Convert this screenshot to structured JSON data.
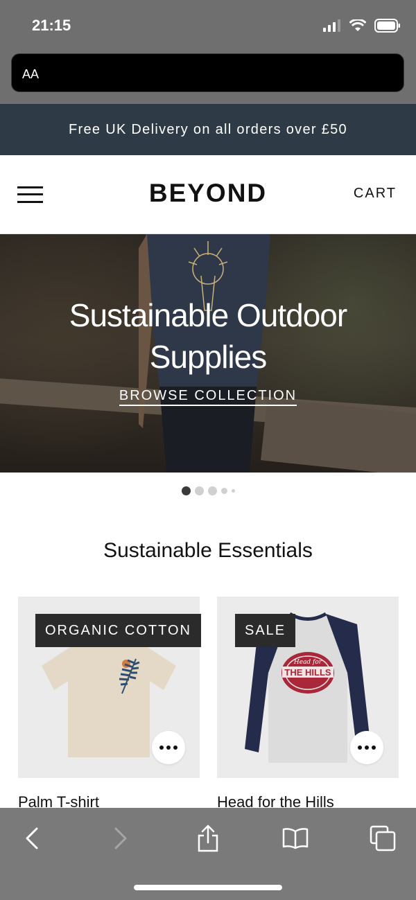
{
  "status_bar": {
    "time": "21:15",
    "icons": [
      "signal-icon",
      "wifi-icon",
      "battery-icon"
    ]
  },
  "browser": {
    "url_prefix": "AA",
    "back_icon": "chevron-left-icon",
    "forward_icon": "chevron-right-icon",
    "share_icon": "share-icon",
    "bookmarks_icon": "book-icon",
    "tabs_icon": "tabs-icon"
  },
  "promo": {
    "text": "Free UK Delivery on all orders over £50"
  },
  "header": {
    "logo": "BEYOND",
    "cart_label": "CART",
    "menu_icon": "hamburger-icon"
  },
  "hero": {
    "title_line1": "Sustainable Outdoor",
    "title_line2": "Supplies",
    "cta": "BROWSE COLLECTION",
    "slide_index": 1,
    "slide_count": 5
  },
  "section": {
    "title": "Sustainable Essentials"
  },
  "products": [
    {
      "name": "Palm T-shirt",
      "badge": "ORGANIC COTTON",
      "more_icon": "more-dots-icon"
    },
    {
      "name": "Head for the Hills",
      "badge": "SALE",
      "more_icon": "more-dots-icon",
      "print_text": "Head for THE HILLS"
    }
  ],
  "colors": {
    "promo_bg": "#2e3a45",
    "badge_bg": "#2b2b2b",
    "card_bg": "#ebebeb"
  }
}
